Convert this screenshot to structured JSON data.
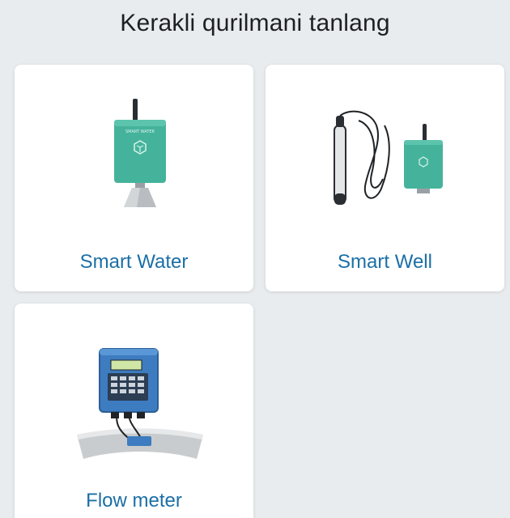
{
  "header": {
    "title": "Kerakli qurilmani tanlang"
  },
  "devices": [
    {
      "label": "Smart Water",
      "icon": "smart-water-sensor-icon"
    },
    {
      "label": "Smart Well",
      "icon": "smart-well-probe-icon"
    },
    {
      "label": "Flow meter",
      "icon": "flow-meter-icon"
    }
  ],
  "colors": {
    "background": "#e9ecef",
    "card": "#ffffff",
    "label": "#1b6fa6",
    "device_body": "#45b39c",
    "flow_meter_body": "#3d7cc0"
  }
}
